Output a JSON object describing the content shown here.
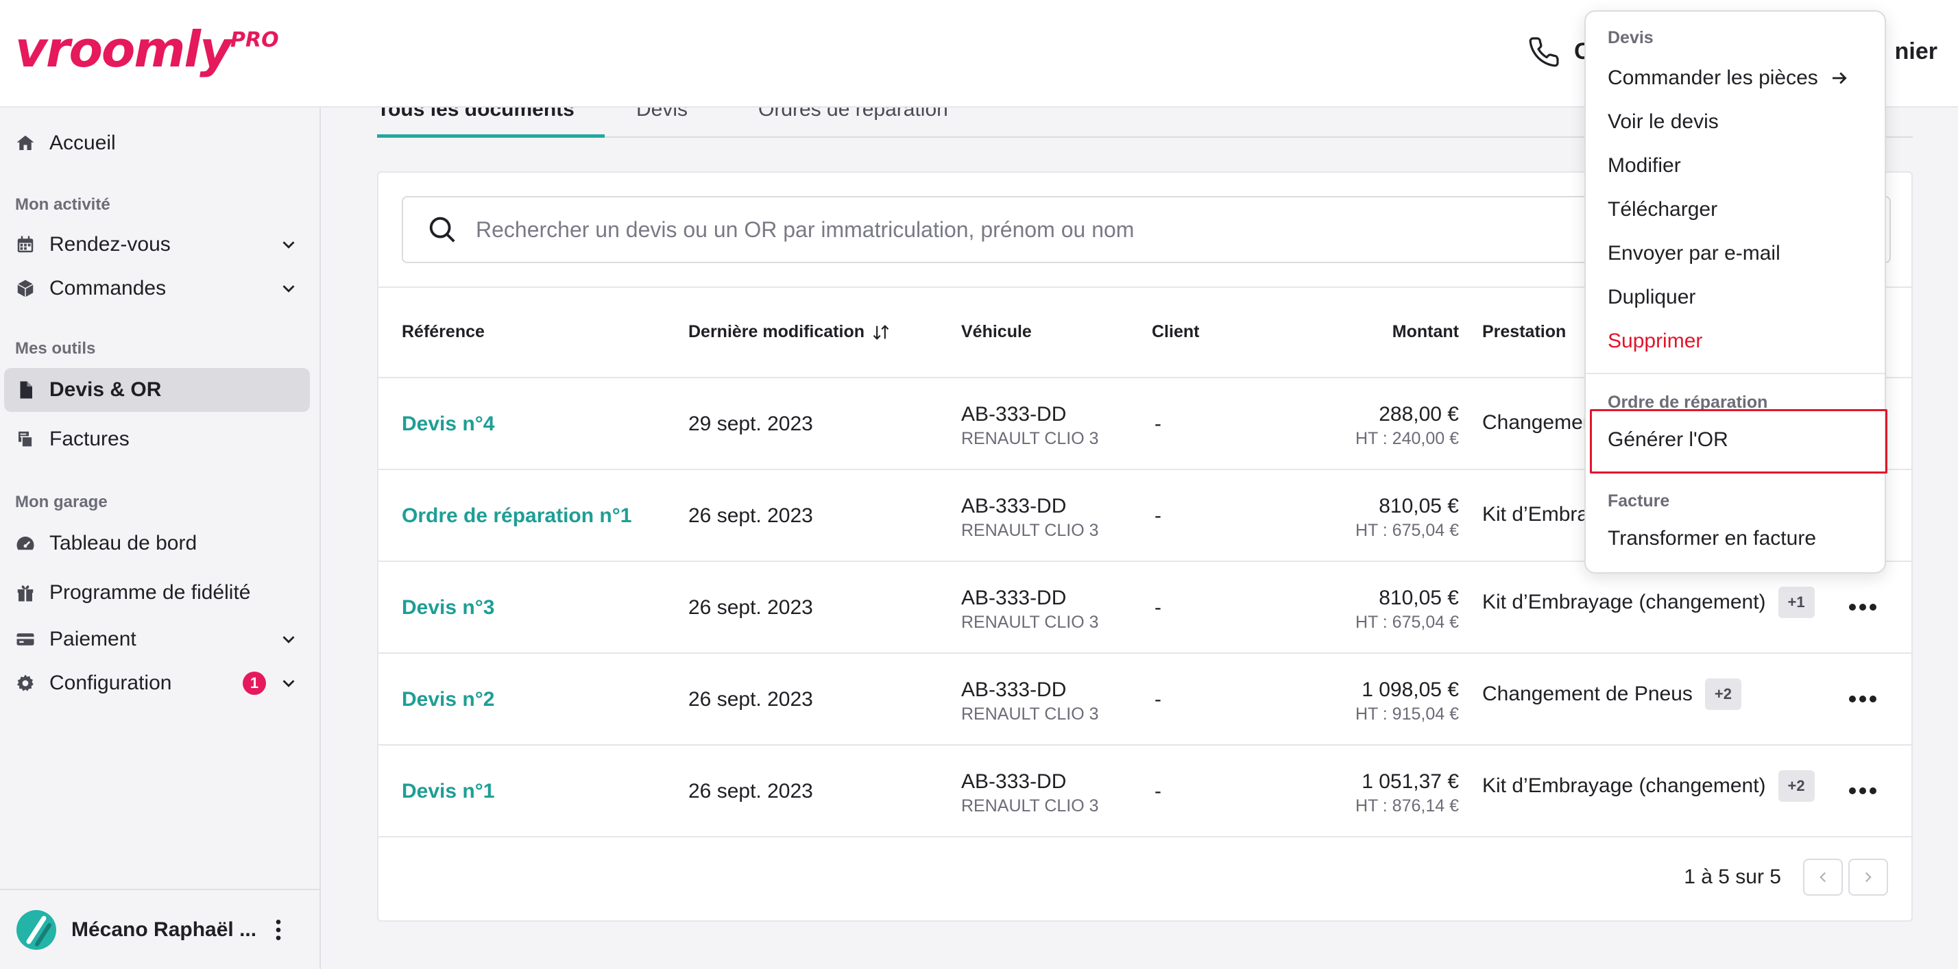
{
  "header": {
    "logo_main": "vroomly",
    "logo_sup": "PRO",
    "partial_left": "C",
    "partial_right": "nier"
  },
  "sidebar": {
    "home": "Accueil",
    "section_activity": "Mon activité",
    "appointments": "Rendez-vous",
    "orders": "Commandes",
    "section_tools": "Mes outils",
    "quotes": "Devis & OR",
    "invoices": "Factures",
    "section_garage": "Mon garage",
    "dashboard": "Tableau de bord",
    "loyalty": "Programme de fidélité",
    "payment": "Paiement",
    "configuration": "Configuration",
    "configuration_badge": "1",
    "user_name": "Mécano Raphaël ..."
  },
  "tabs": [
    {
      "label": "Tous les documents"
    },
    {
      "label": "Devis"
    },
    {
      "label": "Ordres de réparation"
    }
  ],
  "search": {
    "placeholder": "Rechercher un devis ou un OR par immatriculation, prénom ou nom"
  },
  "table": {
    "headers": {
      "reference": "Référence",
      "modified": "Dernière modification",
      "vehicle": "Véhicule",
      "client": "Client",
      "amount": "Montant",
      "service": "Prestation"
    },
    "rows": [
      {
        "ref": "Devis n°4",
        "date": "29 sept. 2023",
        "plate": "AB-333-DD",
        "model": "RENAULT CLIO 3",
        "client": "-",
        "amount": "288,00 €",
        "ht": "HT : 240,00 €",
        "service": "Changement de P",
        "extra": ""
      },
      {
        "ref": "Ordre de réparation n°1",
        "date": "26 sept. 2023",
        "plate": "AB-333-DD",
        "model": "RENAULT CLIO 3",
        "client": "-",
        "amount": "810,05 €",
        "ht": "HT : 675,04 €",
        "service": "Kit d’Embrayage (",
        "extra": ""
      },
      {
        "ref": "Devis n°3",
        "date": "26 sept. 2023",
        "plate": "AB-333-DD",
        "model": "RENAULT CLIO 3",
        "client": "-",
        "amount": "810,05 €",
        "ht": "HT : 675,04 €",
        "service": "Kit d’Embrayage (changement)",
        "extra": "+1"
      },
      {
        "ref": "Devis n°2",
        "date": "26 sept. 2023",
        "plate": "AB-333-DD",
        "model": "RENAULT CLIO 3",
        "client": "-",
        "amount": "1 098,05 €",
        "ht": "HT : 915,04 €",
        "service": "Changement de Pneus",
        "extra": "+2"
      },
      {
        "ref": "Devis n°1",
        "date": "26 sept. 2023",
        "plate": "AB-333-DD",
        "model": "RENAULT CLIO 3",
        "client": "-",
        "amount": "1 051,37 €",
        "ht": "HT : 876,14 €",
        "service": "Kit d’Embrayage (changement)",
        "extra": "+2"
      }
    ]
  },
  "pagination": {
    "text": "1 à 5 sur 5"
  },
  "menu": {
    "section_quote": "Devis",
    "order_parts": "Commander les pièces",
    "view_quote": "Voir le devis",
    "edit": "Modifier",
    "download": "Télécharger",
    "send_email": "Envoyer par e-mail",
    "duplicate": "Dupliquer",
    "delete": "Supprimer",
    "section_repair": "Ordre de réparation",
    "generate_or": "Générer l'OR",
    "section_invoice": "Facture",
    "to_invoice": "Transformer en facture"
  },
  "colors": {
    "brand": "#e5195c",
    "accent": "#1e9e96",
    "danger": "#e0162b"
  }
}
